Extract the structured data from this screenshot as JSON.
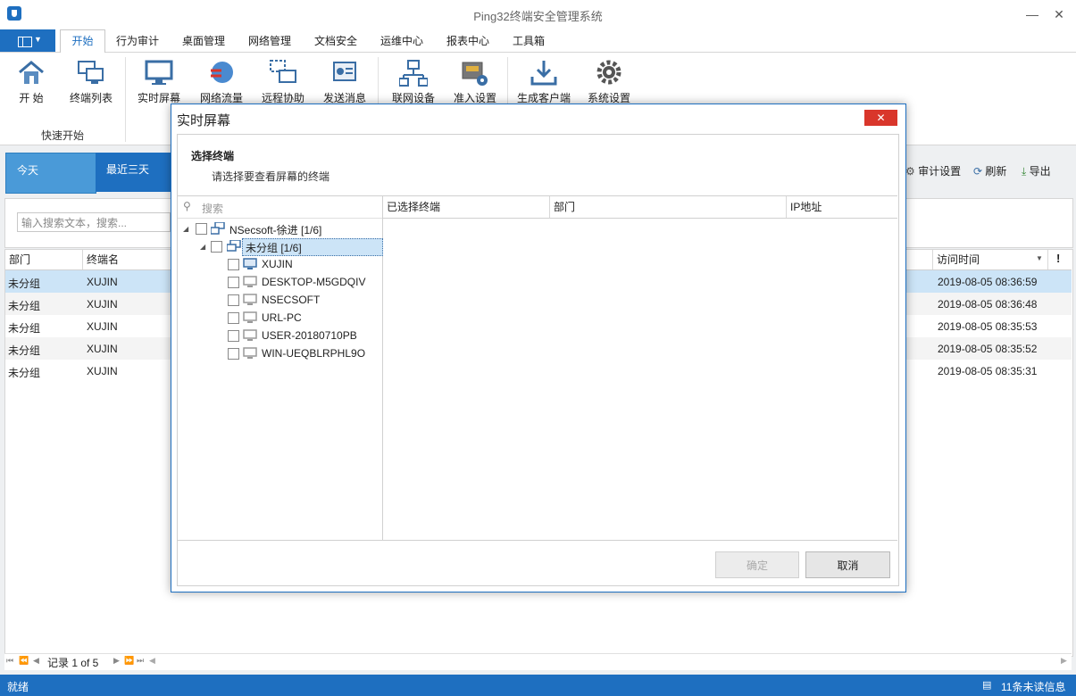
{
  "app": {
    "title": "Ping32终端安全管理系统"
  },
  "menu": {
    "tabs": [
      "开始",
      "行为审计",
      "桌面管理",
      "网络管理",
      "文档安全",
      "运维中心",
      "报表中心",
      "工具箱"
    ]
  },
  "ribbon": {
    "buttons": [
      "开 始",
      "终端列表",
      "实时屏幕",
      "网络流量",
      "远程协助",
      "发送消息",
      "联网设备",
      "准入设置",
      "生成客户端",
      "系统设置"
    ],
    "group_label": "快速开始"
  },
  "background": {
    "date_tabs": [
      "今天",
      "最近三天"
    ],
    "toolbar": {
      "audit_settings": "审计设置",
      "refresh": "刷新",
      "export": "导出"
    },
    "search_placeholder": "输入搜索文本，搜索...",
    "columns": {
      "department": "部门",
      "terminal": "终端名",
      "visit_time": "访问时间"
    },
    "rows": [
      {
        "dept": "未分组",
        "terminal": "XUJIN",
        "time": "2019-08-05 08:36:59"
      },
      {
        "dept": "未分组",
        "terminal": "XUJIN",
        "time": "2019-08-05 08:36:48"
      },
      {
        "dept": "未分组",
        "terminal": "XUJIN",
        "time": "2019-08-05 08:35:53"
      },
      {
        "dept": "未分组",
        "terminal": "XUJIN",
        "time": "2019-08-05 08:35:52"
      },
      {
        "dept": "未分组",
        "terminal": "XUJIN",
        "time": "2019-08-05 08:35:31"
      }
    ],
    "pager": "记录 1 of 5"
  },
  "status": {
    "left": "就绪",
    "right": "11条未读信息"
  },
  "dialog": {
    "title": "实时屏幕",
    "heading": "选择终端",
    "subheading": "请选择要查看屏幕的终端",
    "search_placeholder": "搜索",
    "tree": {
      "root": "NSecsoft-徐进  [1/6]",
      "group": "未分组  [1/6]",
      "terminals": [
        "XUJIN",
        "DESKTOP-M5GDQIV",
        "NSECSOFT",
        "URL-PC",
        "USER-20180710PB",
        "WIN-UEQBLRPHL9O"
      ]
    },
    "selected_columns": [
      "已选择终端",
      "部门",
      "IP地址"
    ],
    "ok_label": "确定",
    "cancel_label": "取消"
  },
  "colors": {
    "accent": "#1e6fc0",
    "close": "#d9362b",
    "selected_row": "#cce4f7"
  }
}
